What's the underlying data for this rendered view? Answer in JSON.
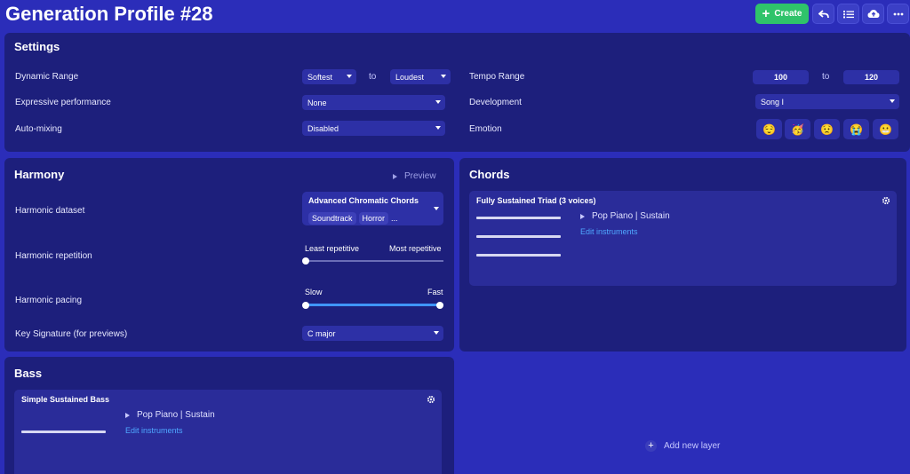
{
  "header": {
    "title": "Generation Profile #28",
    "create_label": "Create"
  },
  "settings": {
    "title": "Settings",
    "dynamic_range": {
      "label": "Dynamic Range",
      "from": "Softest",
      "to_word": "to",
      "to": "Loudest"
    },
    "expressive": {
      "label": "Expressive performance",
      "value": "None"
    },
    "automix": {
      "label": "Auto-mixing",
      "value": "Disabled"
    },
    "tempo": {
      "label": "Tempo Range",
      "min": "100",
      "to_word": "to",
      "max": "120"
    },
    "development": {
      "label": "Development",
      "value": "Song I"
    },
    "emotion": {
      "label": "Emotion",
      "options": [
        "😌",
        "🥳",
        "😟",
        "😭",
        "😬"
      ]
    }
  },
  "harmony": {
    "title": "Harmony",
    "preview_label": "Preview",
    "dataset": {
      "label": "Harmonic dataset",
      "value": "Advanced Chromatic Chords",
      "tags": [
        "Soundtrack",
        "Horror"
      ],
      "more": "..."
    },
    "repetition": {
      "label": "Harmonic repetition",
      "min_label": "Least repetitive",
      "max_label": "Most repetitive",
      "value": 0
    },
    "pacing": {
      "label": "Harmonic pacing",
      "min_label": "Slow",
      "max_label": "Fast",
      "range": [
        0,
        1
      ]
    },
    "key": {
      "label": "Key Signature (for previews)",
      "value": "C major"
    }
  },
  "chords": {
    "title": "Chords",
    "item": {
      "title": "Fully Sustained Triad (3 voices)",
      "instrument": "Pop Piano | Sustain",
      "edit_label": "Edit instruments"
    }
  },
  "bass": {
    "title": "Bass",
    "item": {
      "title": "Simple Sustained Bass",
      "instrument": "Pop Piano | Sustain",
      "edit_label": "Edit instruments"
    }
  },
  "add_layer_label": "Add new layer",
  "colors": {
    "background": "#2b2db9",
    "panel": "#1d1f7c",
    "accent": "#3f95ff",
    "create": "#2fc36a"
  }
}
